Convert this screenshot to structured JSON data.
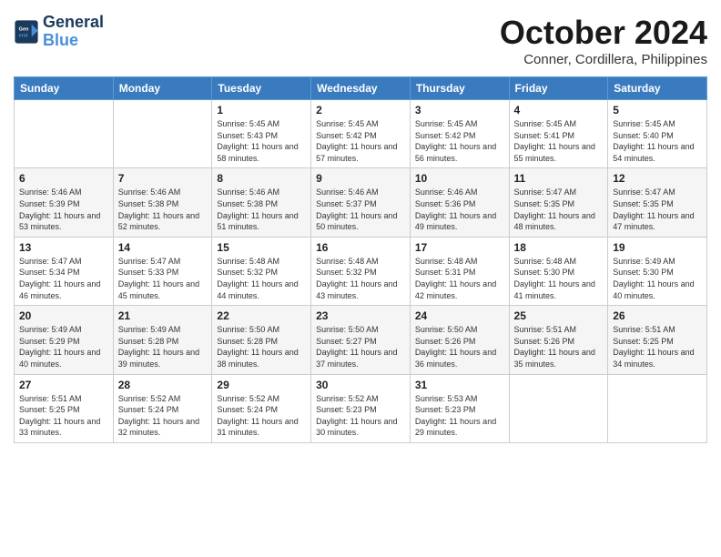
{
  "header": {
    "logo_line1": "General",
    "logo_line2": "Blue",
    "month": "October 2024",
    "location": "Conner, Cordillera, Philippines"
  },
  "weekdays": [
    "Sunday",
    "Monday",
    "Tuesday",
    "Wednesday",
    "Thursday",
    "Friday",
    "Saturday"
  ],
  "weeks": [
    [
      {
        "day": "",
        "info": ""
      },
      {
        "day": "",
        "info": ""
      },
      {
        "day": "1",
        "info": "Sunrise: 5:45 AM\nSunset: 5:43 PM\nDaylight: 11 hours and 58 minutes."
      },
      {
        "day": "2",
        "info": "Sunrise: 5:45 AM\nSunset: 5:42 PM\nDaylight: 11 hours and 57 minutes."
      },
      {
        "day": "3",
        "info": "Sunrise: 5:45 AM\nSunset: 5:42 PM\nDaylight: 11 hours and 56 minutes."
      },
      {
        "day": "4",
        "info": "Sunrise: 5:45 AM\nSunset: 5:41 PM\nDaylight: 11 hours and 55 minutes."
      },
      {
        "day": "5",
        "info": "Sunrise: 5:45 AM\nSunset: 5:40 PM\nDaylight: 11 hours and 54 minutes."
      }
    ],
    [
      {
        "day": "6",
        "info": "Sunrise: 5:46 AM\nSunset: 5:39 PM\nDaylight: 11 hours and 53 minutes."
      },
      {
        "day": "7",
        "info": "Sunrise: 5:46 AM\nSunset: 5:38 PM\nDaylight: 11 hours and 52 minutes."
      },
      {
        "day": "8",
        "info": "Sunrise: 5:46 AM\nSunset: 5:38 PM\nDaylight: 11 hours and 51 minutes."
      },
      {
        "day": "9",
        "info": "Sunrise: 5:46 AM\nSunset: 5:37 PM\nDaylight: 11 hours and 50 minutes."
      },
      {
        "day": "10",
        "info": "Sunrise: 5:46 AM\nSunset: 5:36 PM\nDaylight: 11 hours and 49 minutes."
      },
      {
        "day": "11",
        "info": "Sunrise: 5:47 AM\nSunset: 5:35 PM\nDaylight: 11 hours and 48 minutes."
      },
      {
        "day": "12",
        "info": "Sunrise: 5:47 AM\nSunset: 5:35 PM\nDaylight: 11 hours and 47 minutes."
      }
    ],
    [
      {
        "day": "13",
        "info": "Sunrise: 5:47 AM\nSunset: 5:34 PM\nDaylight: 11 hours and 46 minutes."
      },
      {
        "day": "14",
        "info": "Sunrise: 5:47 AM\nSunset: 5:33 PM\nDaylight: 11 hours and 45 minutes."
      },
      {
        "day": "15",
        "info": "Sunrise: 5:48 AM\nSunset: 5:32 PM\nDaylight: 11 hours and 44 minutes."
      },
      {
        "day": "16",
        "info": "Sunrise: 5:48 AM\nSunset: 5:32 PM\nDaylight: 11 hours and 43 minutes."
      },
      {
        "day": "17",
        "info": "Sunrise: 5:48 AM\nSunset: 5:31 PM\nDaylight: 11 hours and 42 minutes."
      },
      {
        "day": "18",
        "info": "Sunrise: 5:48 AM\nSunset: 5:30 PM\nDaylight: 11 hours and 41 minutes."
      },
      {
        "day": "19",
        "info": "Sunrise: 5:49 AM\nSunset: 5:30 PM\nDaylight: 11 hours and 40 minutes."
      }
    ],
    [
      {
        "day": "20",
        "info": "Sunrise: 5:49 AM\nSunset: 5:29 PM\nDaylight: 11 hours and 40 minutes."
      },
      {
        "day": "21",
        "info": "Sunrise: 5:49 AM\nSunset: 5:28 PM\nDaylight: 11 hours and 39 minutes."
      },
      {
        "day": "22",
        "info": "Sunrise: 5:50 AM\nSunset: 5:28 PM\nDaylight: 11 hours and 38 minutes."
      },
      {
        "day": "23",
        "info": "Sunrise: 5:50 AM\nSunset: 5:27 PM\nDaylight: 11 hours and 37 minutes."
      },
      {
        "day": "24",
        "info": "Sunrise: 5:50 AM\nSunset: 5:26 PM\nDaylight: 11 hours and 36 minutes."
      },
      {
        "day": "25",
        "info": "Sunrise: 5:51 AM\nSunset: 5:26 PM\nDaylight: 11 hours and 35 minutes."
      },
      {
        "day": "26",
        "info": "Sunrise: 5:51 AM\nSunset: 5:25 PM\nDaylight: 11 hours and 34 minutes."
      }
    ],
    [
      {
        "day": "27",
        "info": "Sunrise: 5:51 AM\nSunset: 5:25 PM\nDaylight: 11 hours and 33 minutes."
      },
      {
        "day": "28",
        "info": "Sunrise: 5:52 AM\nSunset: 5:24 PM\nDaylight: 11 hours and 32 minutes."
      },
      {
        "day": "29",
        "info": "Sunrise: 5:52 AM\nSunset: 5:24 PM\nDaylight: 11 hours and 31 minutes."
      },
      {
        "day": "30",
        "info": "Sunrise: 5:52 AM\nSunset: 5:23 PM\nDaylight: 11 hours and 30 minutes."
      },
      {
        "day": "31",
        "info": "Sunrise: 5:53 AM\nSunset: 5:23 PM\nDaylight: 11 hours and 29 minutes."
      },
      {
        "day": "",
        "info": ""
      },
      {
        "day": "",
        "info": ""
      }
    ]
  ]
}
